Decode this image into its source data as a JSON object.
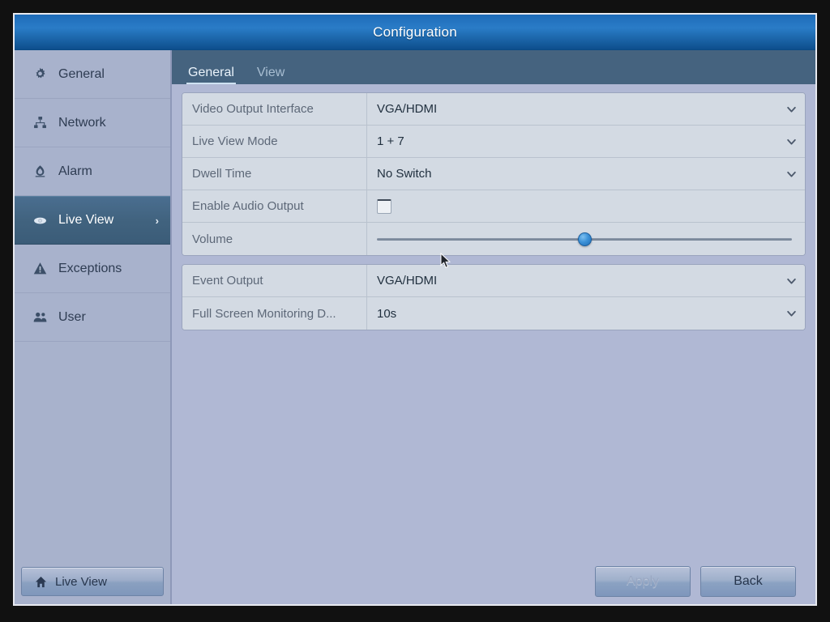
{
  "window": {
    "title": "Configuration"
  },
  "sidebar": {
    "items": [
      {
        "label": "General",
        "icon": "gear-icon",
        "selected": false,
        "arrow": ""
      },
      {
        "label": "Network",
        "icon": "network-icon",
        "selected": false,
        "arrow": ""
      },
      {
        "label": "Alarm",
        "icon": "alarm-icon",
        "selected": false,
        "arrow": ""
      },
      {
        "label": "Live View",
        "icon": "eye-icon",
        "selected": true,
        "arrow": "›"
      },
      {
        "label": "Exceptions",
        "icon": "warning-icon",
        "selected": false,
        "arrow": ""
      },
      {
        "label": "User",
        "icon": "users-icon",
        "selected": false,
        "arrow": ""
      }
    ],
    "live_view_button": "Live View"
  },
  "tabs": [
    {
      "label": "General",
      "active": true
    },
    {
      "label": "View",
      "active": false
    }
  ],
  "form": {
    "group1": [
      {
        "label": "Video Output Interface",
        "value": "VGA/HDMI",
        "control": "select"
      },
      {
        "label": "Live View Mode",
        "value": "1 + 7",
        "control": "select"
      },
      {
        "label": "Dwell Time",
        "value": "No Switch",
        "control": "select"
      },
      {
        "label": "Enable Audio Output",
        "value": "",
        "control": "checkbox",
        "checked": false
      },
      {
        "label": "Volume",
        "value": "",
        "control": "slider",
        "percent": 50
      }
    ],
    "group2": [
      {
        "label": "Event Output",
        "value": "VGA/HDMI",
        "control": "select"
      },
      {
        "label": "Full Screen Monitoring D...",
        "value": "10s",
        "control": "select"
      }
    ]
  },
  "footer": {
    "apply_label": "Apply",
    "apply_disabled": true,
    "back_label": "Back"
  },
  "colors": {
    "window_background": "#b0b8d4",
    "titlebar_blue": "#2a7cc7",
    "tabbar": "#45637f",
    "row_background": "#d3dae3",
    "selected_sidebar": "#436585",
    "label_text": "#5d6878",
    "value_text": "#21303f",
    "slider_thumb": "#3d92d8"
  }
}
